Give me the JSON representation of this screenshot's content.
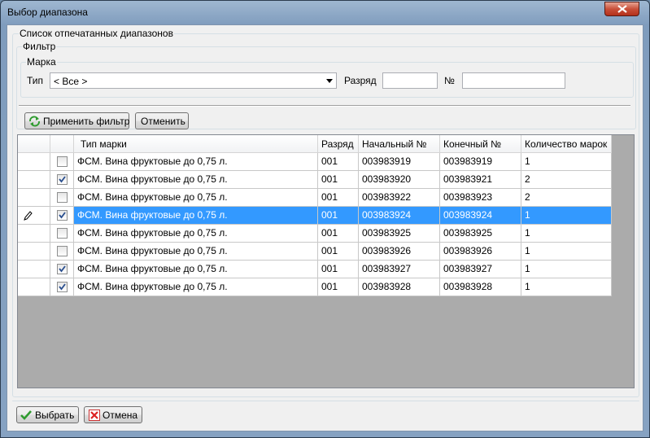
{
  "window": {
    "title": "Выбор диапазона"
  },
  "group_main": {
    "legend": "Список отпечатанных диапазонов"
  },
  "group_filter": {
    "legend": "Фильтр"
  },
  "group_mark": {
    "legend": "Марка"
  },
  "filter": {
    "type_label": "Тип",
    "type_value": "< Все >",
    "grade_label": "Разряд",
    "grade_value": "",
    "number_label": "№",
    "number_value": ""
  },
  "buttons": {
    "apply_filter": "Применить фильтр",
    "cancel_filter": "Отменить",
    "select": "Выбрать",
    "cancel": "Отмена"
  },
  "grid": {
    "headers": [
      "Тип марки",
      "Разряд",
      "Начальный №",
      "Конечный №",
      "Количество марок"
    ],
    "rows": [
      {
        "checked": false,
        "type": "ФСМ. Вина фруктовые до 0,75 л.",
        "grade": "001",
        "start": "003983919",
        "end": "003983919",
        "count": "1"
      },
      {
        "checked": true,
        "type": "ФСМ. Вина фруктовые до 0,75 л.",
        "grade": "001",
        "start": "003983920",
        "end": "003983921",
        "count": "2"
      },
      {
        "checked": false,
        "type": "ФСМ. Вина фруктовые до 0,75 л.",
        "grade": "001",
        "start": "003983922",
        "end": "003983923",
        "count": "2"
      },
      {
        "checked": true,
        "type": "ФСМ. Вина фруктовые до 0,75 л.",
        "grade": "001",
        "start": "003983924",
        "end": "003983924",
        "count": "1"
      },
      {
        "checked": false,
        "type": "ФСМ. Вина фруктовые до 0,75 л.",
        "grade": "001",
        "start": "003983925",
        "end": "003983925",
        "count": "1"
      },
      {
        "checked": false,
        "type": "ФСМ. Вина фруктовые до 0,75 л.",
        "grade": "001",
        "start": "003983926",
        "end": "003983926",
        "count": "1"
      },
      {
        "checked": true,
        "type": "ФСМ. Вина фруктовые до 0,75 л.",
        "grade": "001",
        "start": "003983927",
        "end": "003983927",
        "count": "1"
      },
      {
        "checked": true,
        "type": "ФСМ. Вина фруктовые до 0,75 л.",
        "grade": "001",
        "start": "003983928",
        "end": "003983928",
        "count": "1"
      }
    ],
    "selected_row": 3
  },
  "colors": {
    "selection": "#3399ff",
    "grid_background": "#ababab",
    "close_button": "#c9503a"
  }
}
